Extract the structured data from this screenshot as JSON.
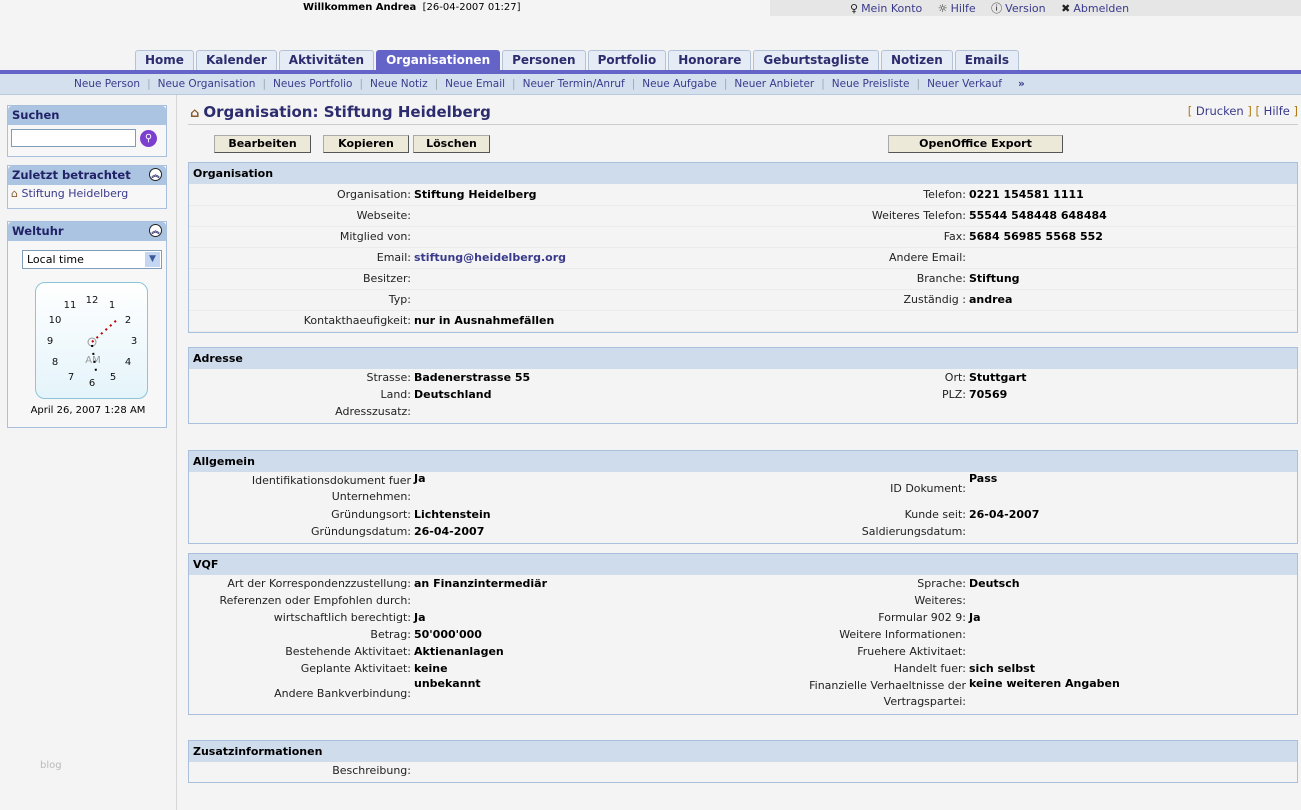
{
  "header": {
    "welcome": "Willkommen Andrea",
    "datetime": "[26-04-2007 01:27]",
    "links": [
      {
        "label": "Mein Konto",
        "icon": "user-icon"
      },
      {
        "label": "Hilfe",
        "icon": "lightbulb-icon"
      },
      {
        "label": "Version",
        "icon": "info-icon"
      },
      {
        "label": "Abmelden",
        "icon": "logout-icon"
      }
    ]
  },
  "tabs": [
    "Home",
    "Kalender",
    "Aktivitäten",
    "Organisationen",
    "Personen",
    "Portfolio",
    "Honorare",
    "Geburtstagliste",
    "Notizen",
    "Emails"
  ],
  "active_tab": "Organisationen",
  "subnav": [
    "Neue Person",
    "Neue Organisation",
    "Neues Portfolio",
    "Neue Notiz",
    "Neue Email",
    "Neuer Termin/Anruf",
    "Neue Aufgabe",
    "Neuer Anbieter",
    "Neue Preisliste",
    "Neuer Verkauf"
  ],
  "subnav_more": "»",
  "sidebar": {
    "search_title": "Suchen",
    "search_value": "",
    "recent_title": "Zuletzt betrachtet",
    "recent_item": "Stiftung Heidelberg",
    "clock_title": "Weltuhr",
    "clock_select": "Local time",
    "clock_date": "April 26, 2007 1:28 AM",
    "clock_ampm": "AM",
    "blog": "blog"
  },
  "page": {
    "title": "Organisation: Stiftung Heidelberg",
    "print": "Drucken",
    "help": "Hilfe",
    "buttons": {
      "edit": "Bearbeiten",
      "copy": "Kopieren",
      "delete": "Löschen",
      "export": "OpenOffice Export"
    }
  },
  "sections": [
    {
      "title": "Organisation",
      "rows": [
        [
          "Organisation:",
          "Stiftung Heidelberg",
          "Telefon:",
          "0221 154581 1111"
        ],
        [
          "Webseite:",
          "",
          "Weiteres Telefon:",
          "55544 548448 648484"
        ],
        [
          "Mitglied von:",
          "",
          "Fax:",
          "5684 56985 5568 552"
        ],
        [
          "Email:",
          "stiftung@heidelberg.org",
          "Andere Email:",
          ""
        ],
        [
          "Besitzer:",
          "",
          "Branche:",
          "Stiftung"
        ],
        [
          "Typ:",
          "",
          "Zuständig :",
          "andrea"
        ],
        [
          "Kontakthaeufigkeit:",
          "nur in Ausnahmefällen",
          "",
          ""
        ]
      ]
    },
    {
      "title": "Adresse",
      "rows": [
        [
          "Strasse:",
          "Badenerstrasse 55",
          "Ort:",
          "Stuttgart"
        ],
        [
          "Land:",
          "Deutschland",
          "PLZ:",
          "70569"
        ],
        [
          "Adresszusatz:",
          "",
          "",
          ""
        ]
      ]
    },
    {
      "title": "Allgemein",
      "rows": [
        [
          "Identifikationsdokument fuer Unternehmen:",
          "Ja",
          "ID Dokument:",
          "Pass"
        ],
        [
          "Gründungsort:",
          "Lichtenstein",
          "Kunde seit:",
          "26-04-2007"
        ],
        [
          "Gründungsdatum:",
          "26-04-2007",
          "Saldierungsdatum:",
          ""
        ]
      ]
    },
    {
      "title": "VQF",
      "rows": [
        [
          "Art der Korrespondenzzustellung:",
          "an Finanzintermediär",
          "Sprache:",
          "Deutsch"
        ],
        [
          "Referenzen oder Empfohlen durch:",
          "",
          "Weiteres:",
          ""
        ],
        [
          "wirtschaftlich berechtigt:",
          "Ja",
          "Formular 902 9:",
          "Ja"
        ],
        [
          "Betrag:",
          "50'000'000",
          "Weitere Informationen:",
          ""
        ],
        [
          "Bestehende Aktivitaet:",
          "Aktienanlagen",
          "Fruehere Aktivitaet:",
          ""
        ],
        [
          "Geplante Aktivitaet:",
          "keine",
          "Handelt fuer:",
          "sich selbst"
        ],
        [
          "Andere Bankverbindung:",
          "unbekannt",
          "Finanzielle Verhaeltnisse der Vertragspartei:",
          "keine weiteren Angaben"
        ]
      ]
    },
    {
      "title": "Zusatzinformationen",
      "rows": [
        [
          "Beschreibung:",
          "",
          "",
          ""
        ]
      ]
    }
  ]
}
